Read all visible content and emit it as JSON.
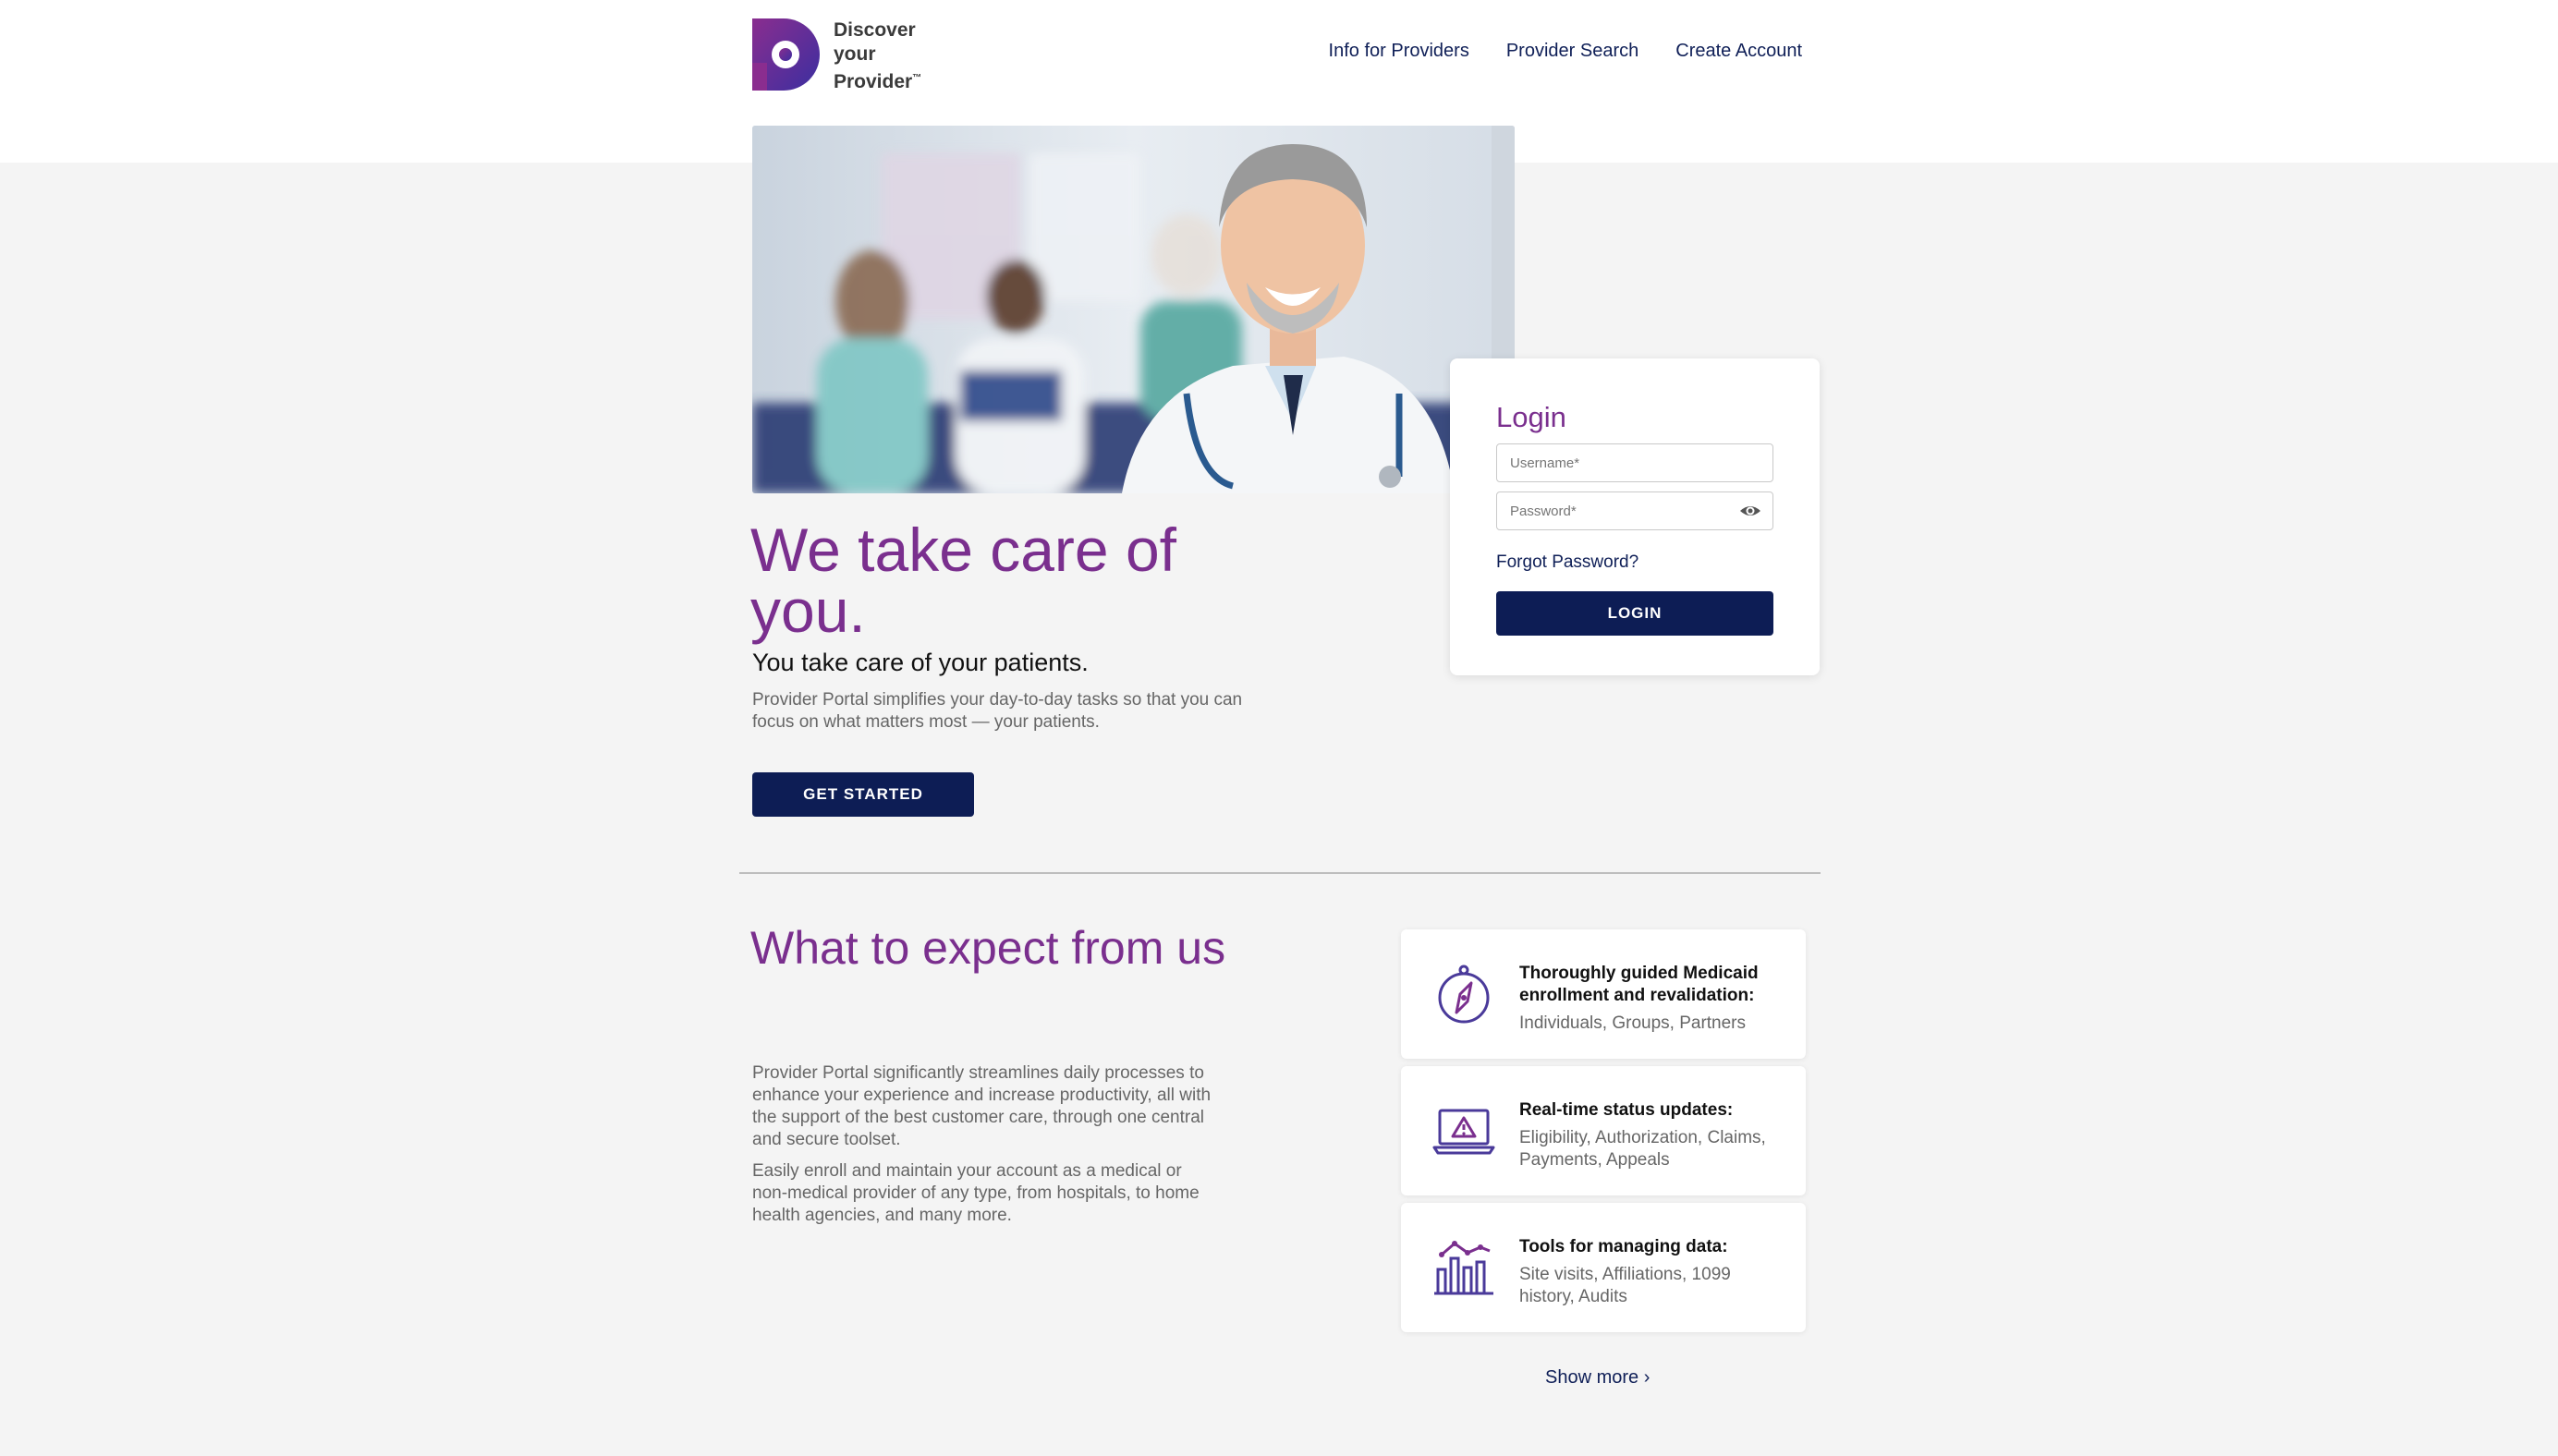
{
  "header": {
    "logo_lines": [
      "Discover",
      "your",
      "Provider"
    ],
    "logo_tm": "™",
    "nav": [
      "Info for Providers",
      "Provider Search",
      "Create Account"
    ]
  },
  "login": {
    "title": "Login",
    "username_placeholder": "Username*",
    "password_placeholder": "Password*",
    "forgot": "Forgot Password?",
    "button": "LOGIN"
  },
  "hero": {
    "title": "We take care of you.",
    "subtitle": "You take care of your patients.",
    "description": "Provider Portal simplifies your day-to-day tasks so that you can focus on what matters most — your patients.",
    "button": "GET STARTED"
  },
  "expect": {
    "title": "What to expect from us",
    "p1": "Provider Portal significantly streamlines daily processes to enhance your experience and increase productivity, all with the support of the best customer care, through one central and secure toolset.",
    "p2": "Easily enroll and maintain your account as a medical or non-medical provider of any type, from hospitals, to home health agencies, and many more.",
    "features": [
      {
        "icon": "compass-icon",
        "title": "Thoroughly guided Medicaid enrollment and revalidation:",
        "desc": "Individuals, Groups, Partners"
      },
      {
        "icon": "laptop-alert-icon",
        "title": "Real-time status updates:",
        "desc": "Eligibility, Authorization, Claims, Payments, Appeals"
      },
      {
        "icon": "bar-chart-icon",
        "title": "Tools for managing data:",
        "desc": "Site visits, Affiliations, 1099 history, Audits"
      }
    ],
    "show_more": "Show more ›"
  },
  "colors": {
    "brand_purple": "#7a2f8e",
    "navy": "#0d1d55",
    "background": "#f4f4f4"
  }
}
